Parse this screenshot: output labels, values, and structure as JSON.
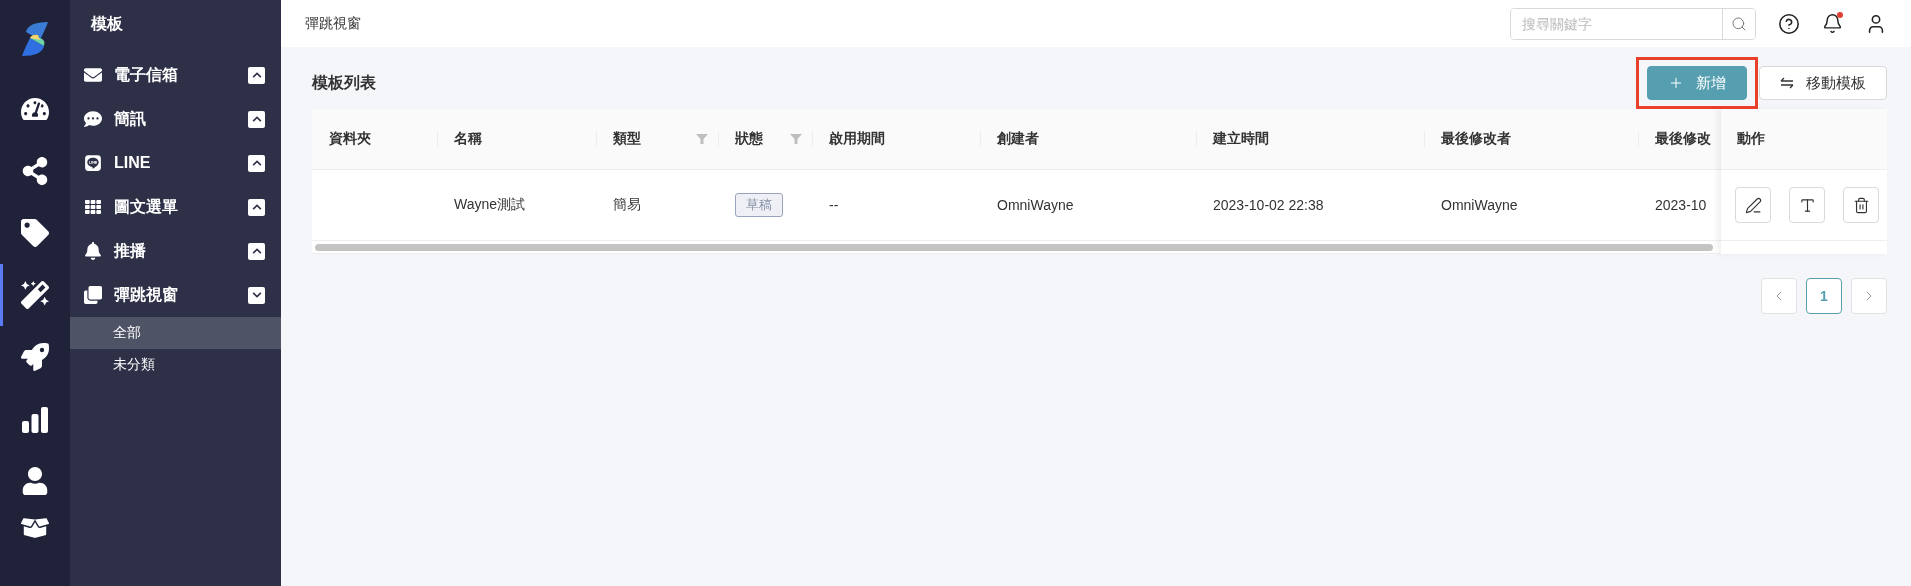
{
  "rail": {
    "items": [
      {
        "kind": "gauge",
        "selected": false
      },
      {
        "kind": "share",
        "selected": false
      },
      {
        "kind": "tag",
        "selected": false
      },
      {
        "kind": "wand",
        "selected": true
      },
      {
        "kind": "rocket",
        "selected": false
      },
      {
        "kind": "chart",
        "selected": false
      },
      {
        "kind": "user",
        "selected": false
      },
      {
        "kind": "box",
        "selected": false
      }
    ]
  },
  "sidebar": {
    "title": "模板",
    "items": [
      {
        "kind": "mail",
        "label": "電子信箱",
        "expanded": false
      },
      {
        "kind": "sms",
        "label": "簡訊",
        "expanded": false
      },
      {
        "kind": "line",
        "label": "LINE",
        "expanded": false
      },
      {
        "kind": "grid",
        "label": "圖文選單",
        "expanded": false
      },
      {
        "kind": "bell",
        "label": "推播",
        "expanded": false
      },
      {
        "kind": "popup",
        "label": "彈跳視窗",
        "expanded": true,
        "children": [
          {
            "label": "全部",
            "selected": true
          },
          {
            "label": "未分類",
            "selected": false
          }
        ]
      }
    ]
  },
  "header": {
    "title": "彈跳視窗",
    "search": {
      "placeholder": "搜尋關鍵字"
    },
    "notification_dot": true
  },
  "page": {
    "title": "模板列表",
    "buttons": [
      {
        "kind": "primary",
        "label": "新增",
        "highlighted": true
      },
      {
        "kind": "default",
        "label": "移動模板",
        "highlighted": false
      }
    ]
  },
  "table": {
    "columns": [
      {
        "label": "資料夾",
        "filter": false
      },
      {
        "label": "名稱",
        "filter": false
      },
      {
        "label": "類型",
        "filter": true
      },
      {
        "label": "狀態",
        "filter": true,
        "kind": "tag"
      },
      {
        "label": "啟用期間",
        "filter": false
      },
      {
        "label": "創建者",
        "filter": false
      },
      {
        "label": "建立時間",
        "filter": false
      },
      {
        "label": "最後修改者",
        "filter": false
      },
      {
        "label": "最後修改",
        "filter": false
      }
    ],
    "action_column": "動作",
    "rows": [
      {
        "cells": [
          "",
          "Wayne測試",
          "簡易",
          "草稿",
          "--",
          "OmniWayne",
          "2023-10-02 22:38",
          "OmniWayne",
          "2023-10"
        ],
        "actions": [
          {
            "kind": "edit"
          },
          {
            "kind": "text"
          },
          {
            "kind": "delete"
          }
        ]
      }
    ]
  },
  "pagination": {
    "pages": [
      {
        "label": "1",
        "selected": true
      }
    ]
  }
}
